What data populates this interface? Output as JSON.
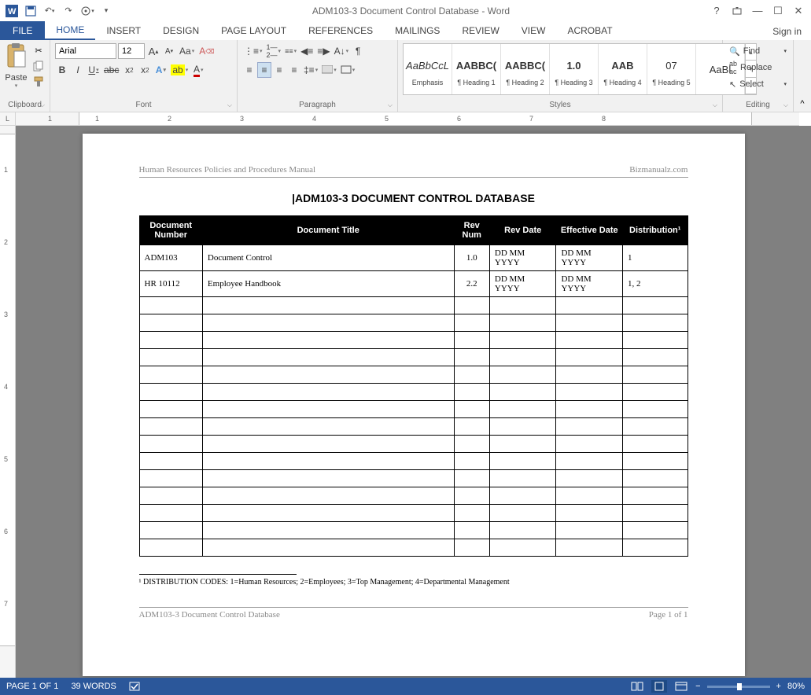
{
  "app": {
    "title": "ADM103-3 Document Control Database - Word",
    "signin": "Sign in"
  },
  "qat": {
    "save": "save",
    "undo": "undo",
    "redo": "redo",
    "touch": "touch"
  },
  "tabs": {
    "file": "FILE",
    "items": [
      "HOME",
      "INSERT",
      "DESIGN",
      "PAGE LAYOUT",
      "REFERENCES",
      "MAILINGS",
      "REVIEW",
      "VIEW",
      "ACROBAT"
    ],
    "active": "HOME"
  },
  "ribbon": {
    "clipboard": {
      "label": "Clipboard",
      "paste": "Paste"
    },
    "font": {
      "label": "Font",
      "name": "Arial",
      "size": "12"
    },
    "paragraph": {
      "label": "Paragraph"
    },
    "styles": {
      "label": "Styles",
      "items": [
        {
          "preview": "AaBbCcL",
          "name": "Emphasis",
          "italic": true
        },
        {
          "preview": "AABBC(",
          "name": "¶ Heading 1",
          "bold": true
        },
        {
          "preview": "AABBC(",
          "name": "¶ Heading 2",
          "bold": true
        },
        {
          "preview": "1.0",
          "name": "¶ Heading 3",
          "bold": true
        },
        {
          "preview": "AAB",
          "name": "¶ Heading 4",
          "bold": true
        },
        {
          "preview": "07",
          "name": "¶ Heading 5"
        },
        {
          "preview": "AaBl",
          "name": ""
        }
      ]
    },
    "editing": {
      "label": "Editing",
      "find": "Find",
      "replace": "Replace",
      "select": "Select"
    }
  },
  "document": {
    "header_left": "Human Resources Policies and Procedures Manual",
    "header_right": "Bizmanualz.com",
    "title": "ADM103-3 DOCUMENT CONTROL DATABASE",
    "columns": [
      "Document Number",
      "Document Title",
      "Rev Num",
      "Rev Date",
      "Effective Date",
      "Distribution¹"
    ],
    "rows": [
      {
        "num": "ADM103",
        "title": "Document Control",
        "rev": "1.0",
        "revdate": "DD MM YYYY",
        "effdate": "DD MM YYYY",
        "dist": "1"
      },
      {
        "num": "HR 10112",
        "title": "Employee Handbook",
        "rev": "2.2",
        "revdate": "DD MM YYYY",
        "effdate": "DD MM YYYY",
        "dist": "1, 2"
      }
    ],
    "empty_rows": 15,
    "footnote": "¹ DISTRIBUTION CODES: 1=Human Resources; 2=Employees; 3=Top Management; 4=Departmental Management",
    "footer_left": "ADM103-3 Document Control Database",
    "footer_right": "Page 1 of 1"
  },
  "status": {
    "page": "PAGE 1 OF 1",
    "words": "39 WORDS",
    "zoom": "80%"
  },
  "ruler": {
    "h": [
      "1",
      "1",
      "2",
      "3",
      "4",
      "5",
      "6",
      "7",
      "8"
    ],
    "v": [
      "1",
      "2",
      "3",
      "4",
      "5",
      "6",
      "7"
    ]
  }
}
